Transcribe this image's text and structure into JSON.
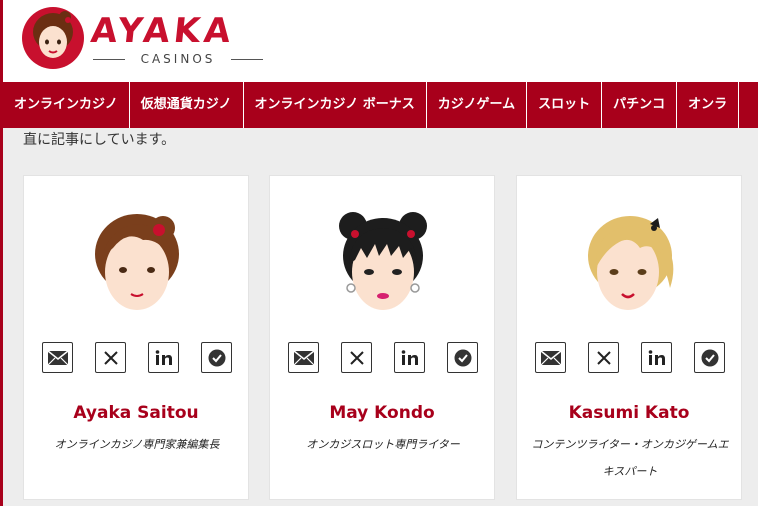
{
  "site": {
    "logo_text": "AYAKA",
    "logo_sub": "CASINOS"
  },
  "nav": {
    "items": [
      {
        "label": "オンラインカジノ"
      },
      {
        "label": "仮想通貨カジノ"
      },
      {
        "label": "オンラインカジノ ボーナス"
      },
      {
        "label": "カジノゲーム"
      },
      {
        "label": "スロット"
      },
      {
        "label": "パチンコ"
      },
      {
        "label": "オンラ"
      }
    ]
  },
  "intro_text": "直に記事にしています。",
  "authors": [
    {
      "name": "Ayaka Saitou",
      "role": "オンラインカジノ専門家兼編集長",
      "hair": "#7a3f1c"
    },
    {
      "name": "May Kondo",
      "role": "オンカジスロット専門ライター",
      "hair": "#1d1d1d"
    },
    {
      "name": "Kasumi Kato",
      "role": "コンテンツライター・オンカジゲームエキスパート",
      "hair": "#e2bf6b"
    }
  ],
  "social_icons": [
    "mail-icon",
    "x-icon",
    "linkedin-icon",
    "verified-icon"
  ],
  "colors": {
    "brand": "#a8001b",
    "logo_red": "#c8102e",
    "background": "#ededed"
  }
}
